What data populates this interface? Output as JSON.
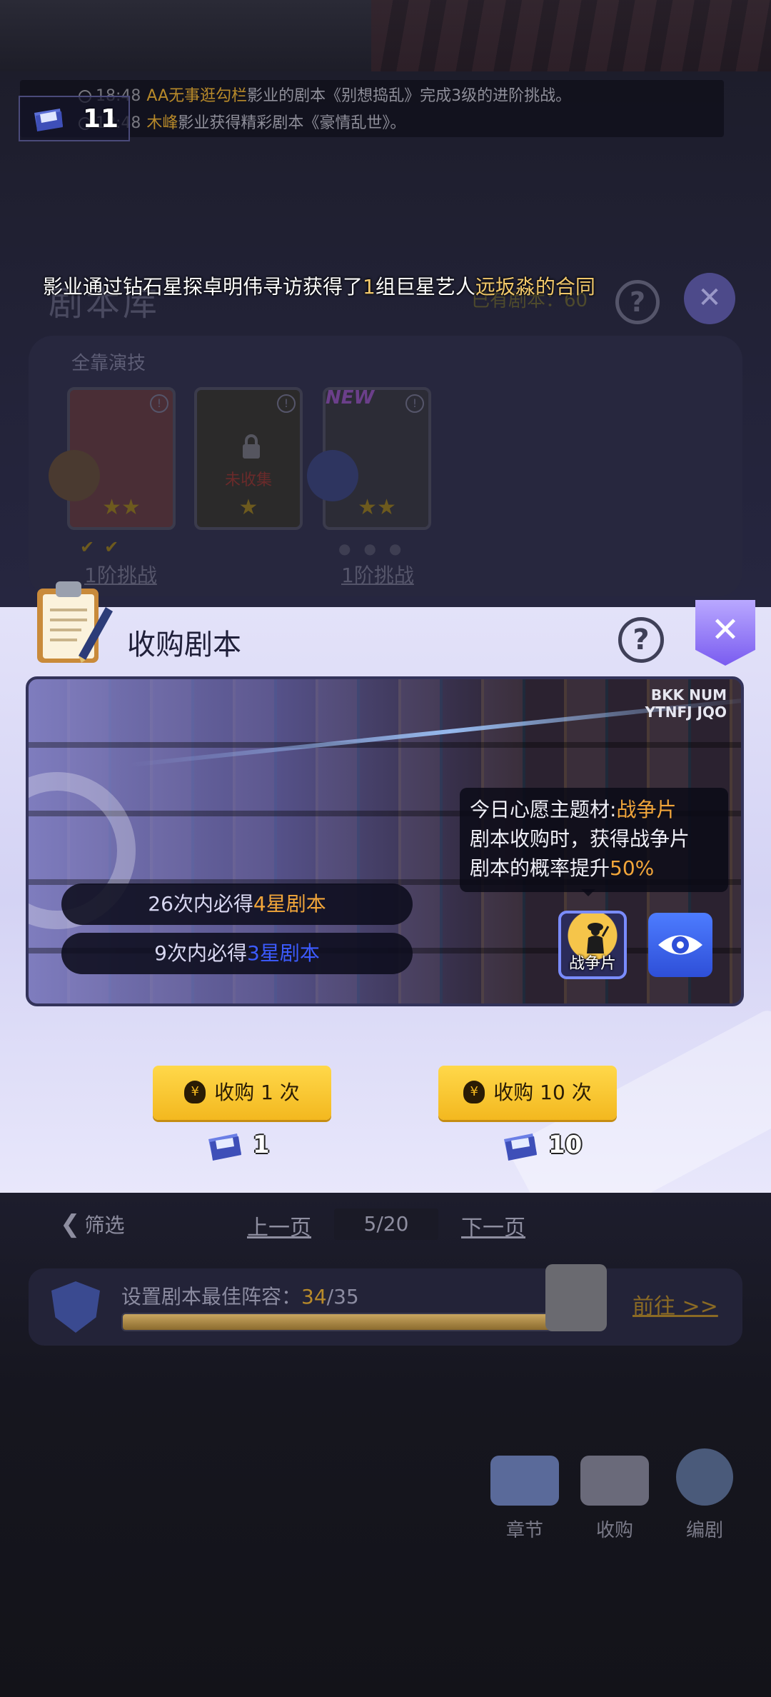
{
  "news": {
    "line1": {
      "time": "18:48",
      "actor": "AA无事逛勾栏",
      "text": "影业的剧本《别想捣乱》完成3级的进阶挑战。"
    },
    "line2": {
      "time": "18:48",
      "actor": "木峰",
      "text": "影业获得精彩剧本《豪情乱世》。"
    }
  },
  "script_count": "11",
  "toast": {
    "part1": "影业通过钻石星探卓明伟寻访获得了",
    "part2": "1",
    "part3": "组巨星艺人",
    "part4": "远坂淼的合同"
  },
  "library": {
    "title": "剧本库",
    "owned_label": "已有剧本：",
    "owned_count": "60",
    "section": "全靠演技",
    "cards": [
      {
        "label": "",
        "challenge": "1阶挑战"
      },
      {
        "label": "未收集",
        "challenge": ""
      },
      {
        "label": "NEW",
        "challenge": "1阶挑战"
      }
    ]
  },
  "purchase": {
    "title": "收购剧本",
    "guarantee1": {
      "prefix": "26次内必得",
      "highlight": "4星剧本"
    },
    "guarantee2": {
      "prefix": "9次内必得",
      "highlight": "3星剧本"
    },
    "wish": {
      "line1_prefix": "今日心愿主题材:",
      "line1_genre": "战争片",
      "line2": "剧本收购时，获得战争片",
      "line3_prefix": "剧本的概率提升",
      "line3_pct": "50%"
    },
    "genre_label": "战争片",
    "wall_corner_text": "BKK NUM\nYTNFJ JQO",
    "buy_once": {
      "label": "收购 1 次",
      "cost": "1"
    },
    "buy_ten": {
      "label": "收购 10 次",
      "cost": "10"
    }
  },
  "pager": {
    "filter": "筛选",
    "prev": "上一页",
    "page": "5/20",
    "next": "下一页"
  },
  "lineup": {
    "label": "设置剧本最佳阵容：",
    "current": "34",
    "total": "/35",
    "progress": 0.9714,
    "goto": "前往 >>"
  },
  "nav": [
    {
      "label": "章节",
      "icon": "chapter-book-icon"
    },
    {
      "label": "收购",
      "icon": "handshake-icon"
    },
    {
      "label": "编剧",
      "icon": "writer-avatar-icon"
    }
  ],
  "colors": {
    "accent_gold": "#f2a63a",
    "button_yellow": "#f3b81f",
    "panel_bg": "#dcdbf6",
    "close_purple": "#7a5cf0"
  }
}
